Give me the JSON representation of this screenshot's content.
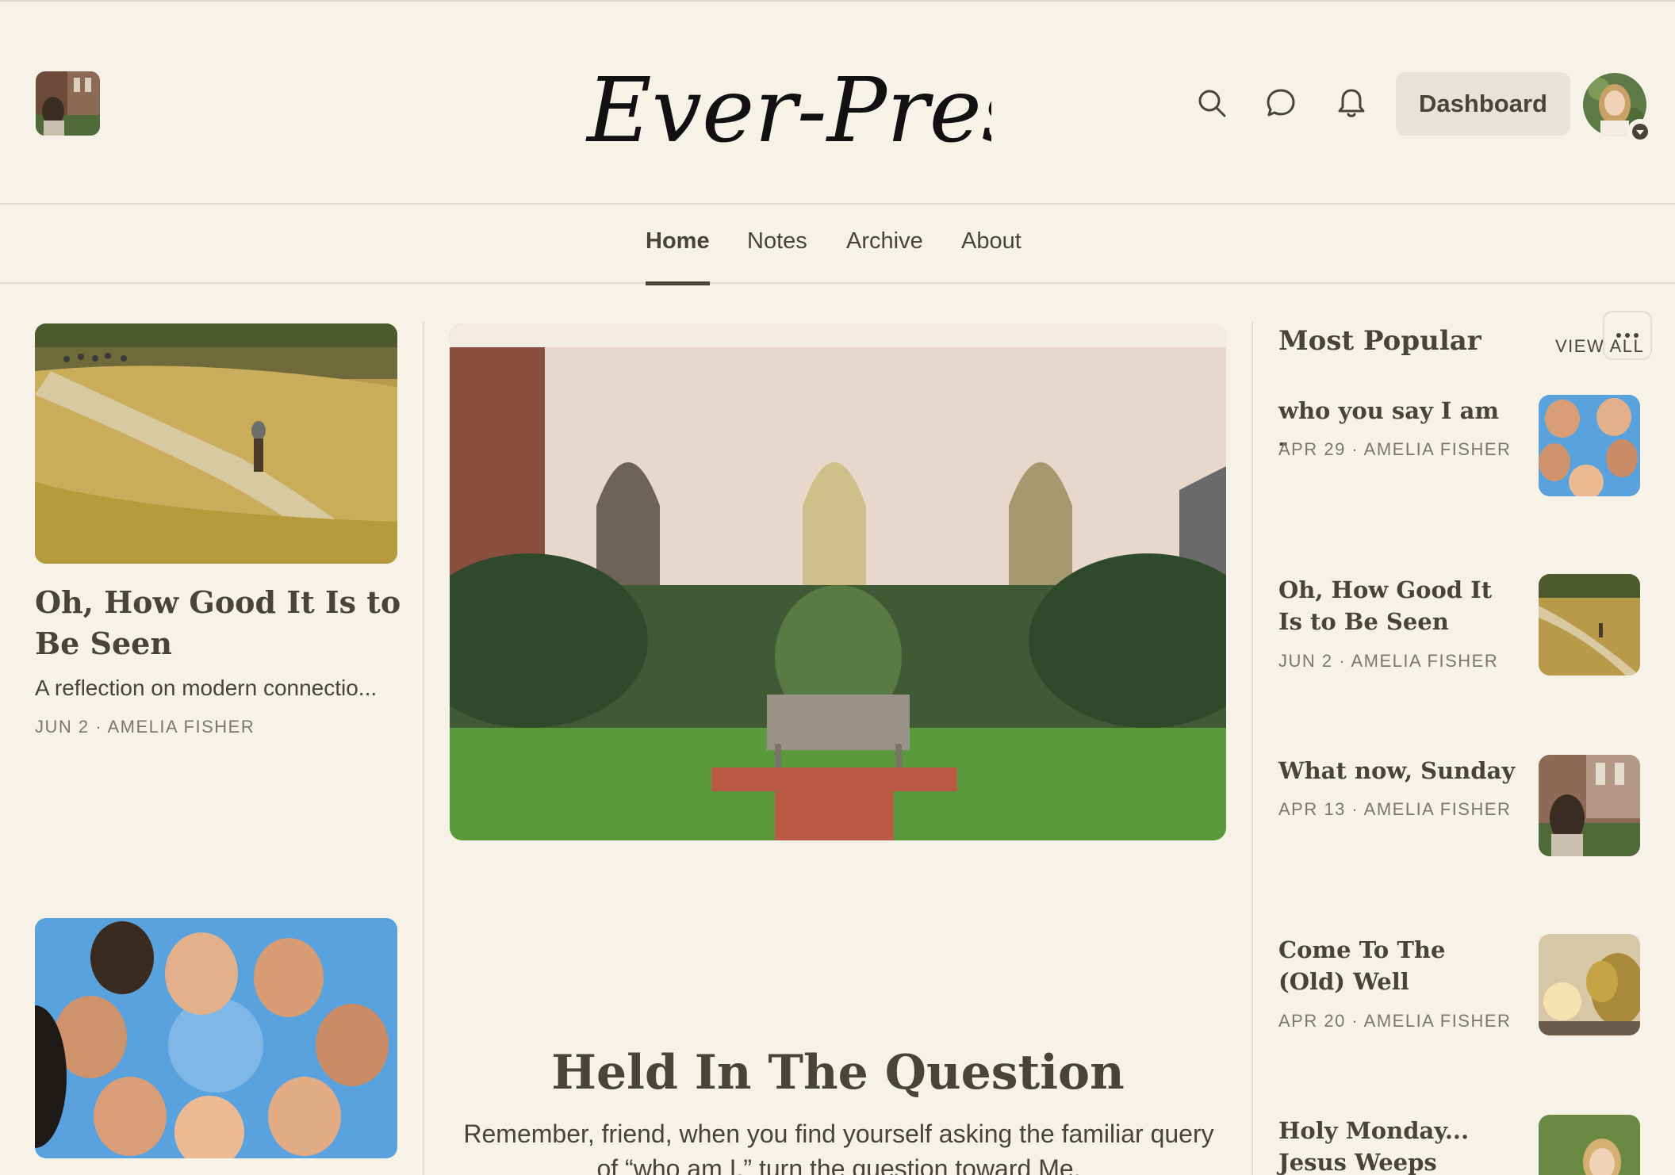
{
  "header": {
    "logo_text": "Ever-Present",
    "dashboard_label": "Dashboard",
    "icons": [
      "search-icon",
      "chat-bubble-icon",
      "bell-icon",
      "chevron-down-icon"
    ]
  },
  "nav": {
    "items": [
      {
        "label": "Home",
        "active": true
      },
      {
        "label": "Notes",
        "active": false
      },
      {
        "label": "Archive",
        "active": false
      },
      {
        "label": "About",
        "active": false
      }
    ]
  },
  "left_posts": [
    {
      "title": "Oh, How Good It Is to Be Seen",
      "subtitle": "A reflection on modern connectio...",
      "meta": "JUN 2 · AMELIA FISHER"
    }
  ],
  "featured": {
    "title": "Held In The Question",
    "subtitle": "Remember, friend, when you find yourself asking the familiar query of “who am I,” turn the question toward Me."
  },
  "most_popular": {
    "title": "Most Popular",
    "view_all": "VIEW ALL",
    "items": [
      {
        "title": "who you say I am -",
        "meta": "APR 29 · AMELIA FISHER"
      },
      {
        "title": "Oh, How Good It Is to Be Seen",
        "meta": "JUN 2 · AMELIA FISHER"
      },
      {
        "title": "What now, Sunday",
        "meta": "APR 13 · AMELIA FISHER"
      },
      {
        "title": "Come To The (Old) Well",
        "meta": "APR 20 · AMELIA FISHER"
      },
      {
        "title": "Holy Monday... Jesus Weeps",
        "meta": ""
      }
    ]
  },
  "colors": {
    "background": "#f6f2e8",
    "text": "#4a4338",
    "muted": "#7d766b",
    "button_bg": "#e8e3d8",
    "divider": "#dedad1"
  }
}
